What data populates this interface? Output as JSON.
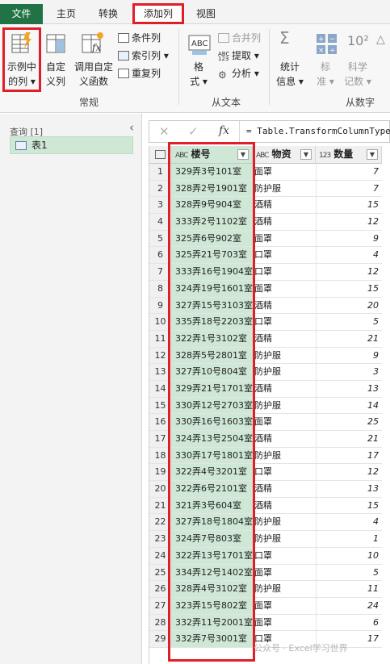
{
  "tabs": [
    "文件",
    "主页",
    "转换",
    "添加列",
    "视图"
  ],
  "ribbon": {
    "example_col": [
      "示例中",
      "的列 ▾"
    ],
    "custom_col": [
      "自定",
      "义列"
    ],
    "invoke_fn": [
      "调用自定",
      "义函数"
    ],
    "conditional": "条件列",
    "index": "索引列 ▾",
    "duplicate": "重复列",
    "format": [
      "格",
      "式 ▾"
    ],
    "merge": "合并列",
    "extract": "提取 ▾",
    "parse": "分析 ▾",
    "stats": [
      "统计",
      "信息 ▾"
    ],
    "standard": [
      "标",
      "准 ▾"
    ],
    "scientific": [
      "科学",
      "记数 ▾"
    ],
    "group_general": "常规",
    "group_from_text": "从文本",
    "group_from_number": "从数字"
  },
  "queries": {
    "header": "查询 [1]",
    "item": "表1"
  },
  "formula": "= Table.TransformColumnTypes",
  "columns": [
    {
      "type": "ABC",
      "name": "楼号"
    },
    {
      "type": "ABC",
      "name": "物资"
    },
    {
      "type": "123",
      "name": "数量"
    }
  ],
  "rows": [
    [
      "1",
      "329弄3号101室",
      "面罩",
      "7"
    ],
    [
      "2",
      "328弄2号1901室",
      "防护服",
      "7"
    ],
    [
      "3",
      "328弄9号904室",
      "酒精",
      "15"
    ],
    [
      "4",
      "333弄2号1102室",
      "酒精",
      "12"
    ],
    [
      "5",
      "325弄6号902室",
      "面罩",
      "9"
    ],
    [
      "6",
      "325弄21号703室",
      "口罩",
      "4"
    ],
    [
      "7",
      "333弄16号1904室",
      "口罩",
      "12"
    ],
    [
      "8",
      "324弄19号1601室",
      "面罩",
      "15"
    ],
    [
      "9",
      "327弄15号3103室",
      "酒精",
      "20"
    ],
    [
      "10",
      "335弄18号2203室",
      "口罩",
      "5"
    ],
    [
      "11",
      "322弄1号3102室",
      "酒精",
      "21"
    ],
    [
      "12",
      "328弄5号2801室",
      "防护服",
      "9"
    ],
    [
      "13",
      "327弄10号804室",
      "防护服",
      "3"
    ],
    [
      "14",
      "329弄21号1701室",
      "酒精",
      "13"
    ],
    [
      "15",
      "330弄12号2703室",
      "防护服",
      "14"
    ],
    [
      "16",
      "330弄16号1603室",
      "面罩",
      "25"
    ],
    [
      "17",
      "324弄13号2504室",
      "酒精",
      "21"
    ],
    [
      "18",
      "330弄17号1801室",
      "防护服",
      "17"
    ],
    [
      "19",
      "322弄4号3201室",
      "口罩",
      "12"
    ],
    [
      "20",
      "322弄6号2101室",
      "酒精",
      "13"
    ],
    [
      "21",
      "321弄3号604室",
      "酒精",
      "15"
    ],
    [
      "22",
      "327弄18号1804室",
      "防护服",
      "4"
    ],
    [
      "23",
      "324弄7号803室",
      "防护服",
      "1"
    ],
    [
      "24",
      "322弄13号1701室",
      "口罩",
      "10"
    ],
    [
      "25",
      "334弄12号1402室",
      "面罩",
      "5"
    ],
    [
      "26",
      "328弄4号3102室",
      "防护服",
      "11"
    ],
    [
      "27",
      "323弄15号802室",
      "面罩",
      "24"
    ],
    [
      "28",
      "332弄11号2001室",
      "面罩",
      "6"
    ],
    [
      "29",
      "332弄7号3001室",
      "口罩",
      "17"
    ]
  ],
  "watermark": "公众号 · Excel学习世界",
  "colors": {
    "file_tab": "#217346",
    "highlight": "#e01e27",
    "selected_col": "#cfe8d6"
  }
}
